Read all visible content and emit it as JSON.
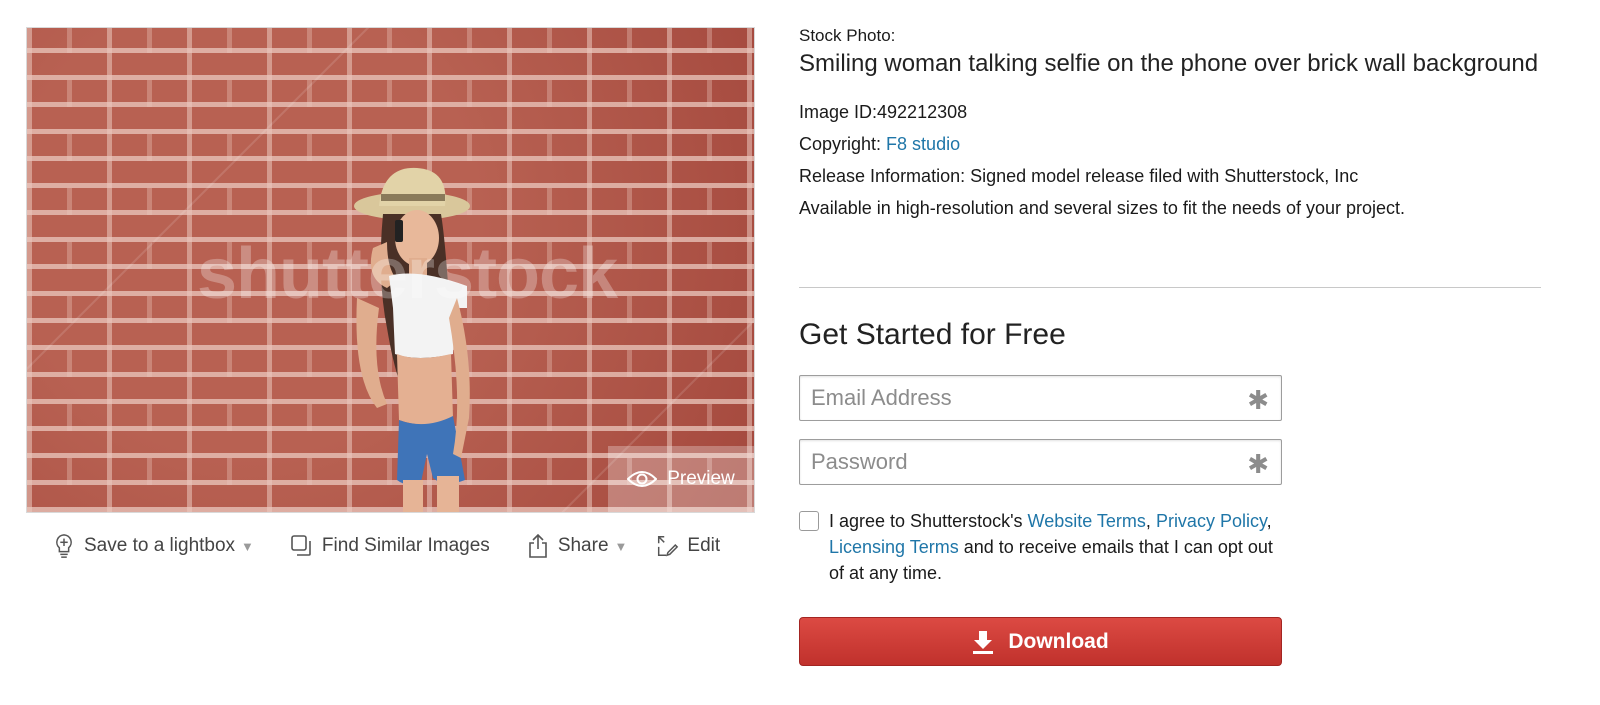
{
  "photo": {
    "watermark": "shutterstock",
    "preview_label": "Preview"
  },
  "actions": {
    "save": "Save to a lightbox",
    "similar": "Find Similar Images",
    "share": "Share",
    "edit": "Edit"
  },
  "info": {
    "label": "Stock Photo:",
    "title": "Smiling woman talking selfie on the phone over brick wall background",
    "image_id": "Image ID:492212308",
    "copyright_label": "Copyright: ",
    "copyright_link": "F8 studio",
    "release": "Release Information: Signed model release filed with Shutterstock, Inc",
    "available": "Available in high-resolution and several sizes to fit the needs of your project."
  },
  "signup": {
    "heading": "Get Started for Free",
    "email_placeholder": "Email Address",
    "password_placeholder": "Password",
    "required_mark": "✱",
    "agree_prefix": "I agree to Shutterstock's ",
    "website_terms": "Website Terms",
    "comma1": ", ",
    "privacy_policy": "Privacy Policy",
    "comma2": ", ",
    "licensing_terms": "Licensing Terms",
    "agree_suffix": " and to receive emails that I can opt out of at any time.",
    "download_label": "Download"
  },
  "colors": {
    "link": "#1f76a8",
    "download": "#c9342f",
    "brick": "#b0584b"
  }
}
